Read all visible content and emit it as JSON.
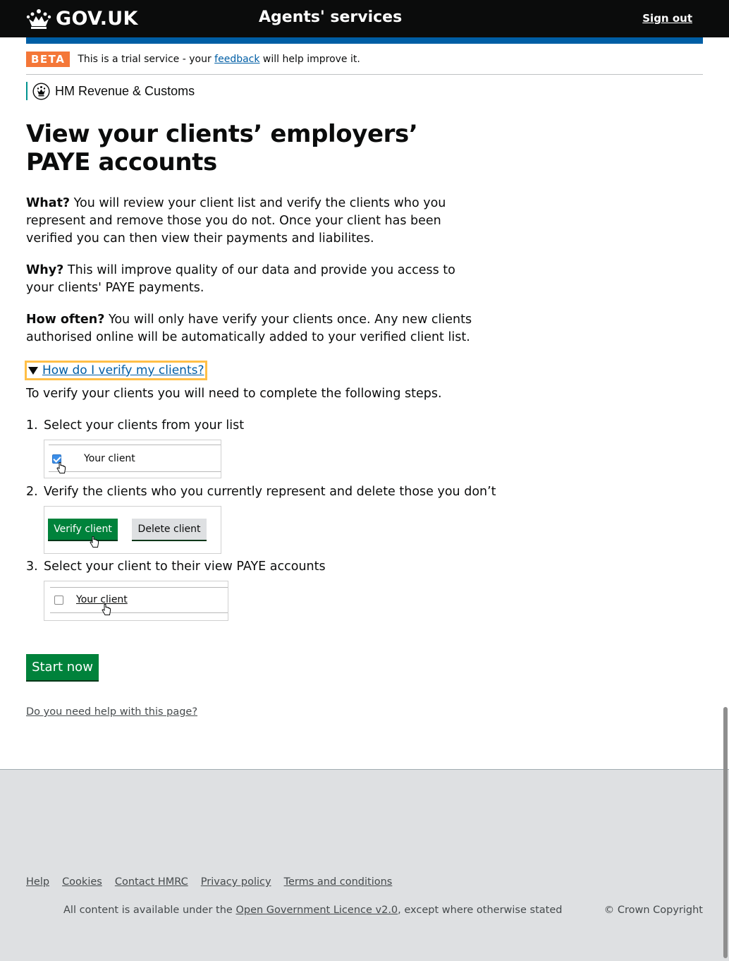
{
  "header": {
    "logo_text": "GOV.UK",
    "service_name": "Agents' services",
    "signout_label": "Sign out"
  },
  "phase_banner": {
    "tag": "BETA",
    "text_before": "This is a trial service - your ",
    "link": "feedback",
    "text_after": " will help improve it."
  },
  "organisation": {
    "name": "HM Revenue & Customs"
  },
  "main": {
    "title": "View your clients’ employers’ PAYE accounts",
    "what_label": "What?",
    "what_text": " You will review your client list and verify the clients who you represent and remove those you do not. Once your client has been verified you can then view their payments and liabilites.",
    "why_label": "Why?",
    "why_text": " This will improve quality of our data and provide you access to your clients' PAYE payments.",
    "how_often_label": "How often?",
    "how_often_text": " You will only have verify your clients once. Any new clients authorised online will be automatically added to your verified client list.",
    "details_summary": "How do I verify my clients?",
    "steps_intro": "To verify your clients you will need to complete the following steps.",
    "steps": [
      {
        "number": "1.",
        "label": "Select your clients from your list",
        "illustration_text": "Your client"
      },
      {
        "number": "2.",
        "label": "Verify the clients who you currently represent and delete those you don’t",
        "verify_label": "Verify client",
        "delete_label": "Delete client"
      },
      {
        "number": "3.",
        "label": "Select your client to their view PAYE accounts",
        "illustration_text": "Your client"
      }
    ],
    "start_button": "Start now",
    "help_link": "Do you need help with this page?"
  },
  "footer": {
    "links": [
      "Help",
      "Cookies",
      "Contact HMRC",
      "Privacy policy",
      "Terms and conditions"
    ],
    "licence_before": "All content is available under the ",
    "licence_link": "Open Government Licence v2.0",
    "licence_after": ", except where otherwise stated",
    "copyright": "© Crown Copyright"
  },
  "colors": {
    "header_bg": "#0b0c0c",
    "brand_blue": "#005ea5",
    "beta_tag": "#f47738",
    "button_green": "#00823b",
    "focus_yellow": "#ffbf47",
    "footer_bg": "#dee0e2"
  }
}
